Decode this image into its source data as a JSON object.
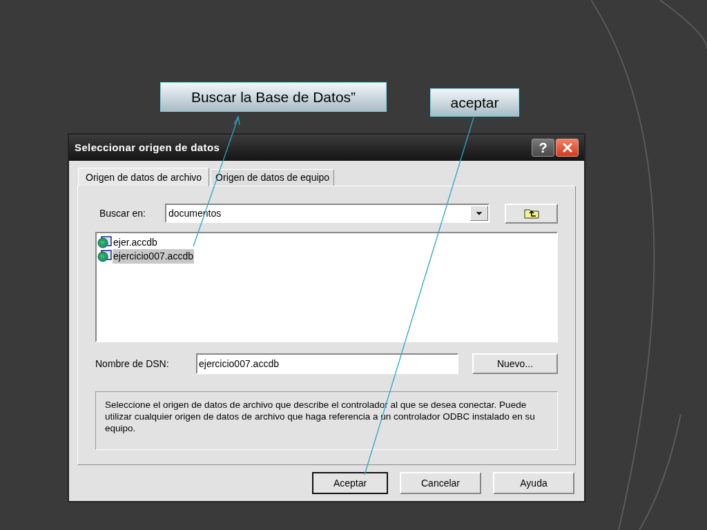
{
  "callouts": [
    {
      "text": "Buscar la Base de Datos”"
    },
    {
      "text": "aceptar"
    }
  ],
  "dialog": {
    "title": "Seleccionar origen de datos",
    "help_button": "?",
    "tabs": [
      {
        "label": "Origen de datos de archivo",
        "selected": true
      },
      {
        "label": "Origen de datos de equipo",
        "selected": false
      }
    ],
    "look_in": {
      "label": "Buscar en:",
      "value": "documentos"
    },
    "files": [
      {
        "name": "ejer.accdb",
        "selected": false
      },
      {
        "name": "ejercicio007.accdb",
        "selected": true
      }
    ],
    "dsn": {
      "label": "Nombre de DSN:",
      "value": "ejercicio007.accdb"
    },
    "new_button": "Nuevo...",
    "description": "Seleccione el origen de datos de archivo que describe el controlador al que se desea conectar. Puede utilizar cualquier origen de datos de archivo que haga referencia a un controlador ODBC instalado en su equipo.",
    "buttons": [
      {
        "label": "Aceptar",
        "default": true
      },
      {
        "label": "Cancelar",
        "default": false
      },
      {
        "label": "Ayuda",
        "default": false
      }
    ]
  }
}
